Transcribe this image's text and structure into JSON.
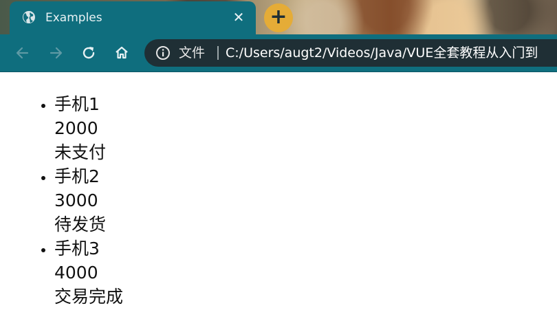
{
  "browser": {
    "tab": {
      "title": "Examples",
      "close_glyph": "✕"
    },
    "new_tab_glyph": "+",
    "toolbar": {
      "back": "back-arrow-icon",
      "forward": "forward-arrow-icon",
      "reload": "reload-icon",
      "home": "home-icon"
    },
    "address_bar": {
      "scheme_label": "文件",
      "url": "C:/Users/augt2/Videos/Java/VUE全套教程从入门到"
    },
    "colors": {
      "frame": "#0f6e7e",
      "omnibox": "#1f2f35",
      "new_tab_button": "#e5ac37"
    }
  },
  "products": [
    {
      "name": "手机1",
      "price": "2000",
      "status": "未支付"
    },
    {
      "name": "手机2",
      "price": "3000",
      "status": "待发货"
    },
    {
      "name": "手机3",
      "price": "4000",
      "status": "交易完成"
    }
  ]
}
